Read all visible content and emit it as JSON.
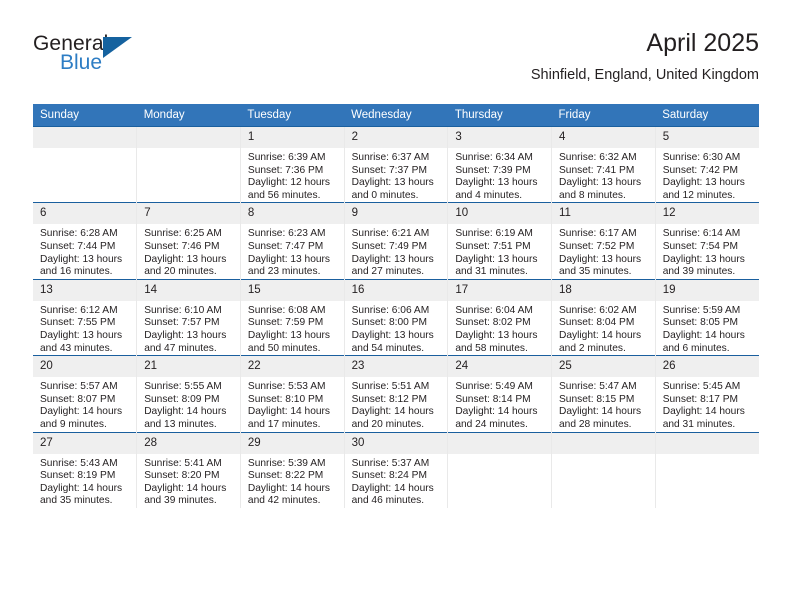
{
  "brand": {
    "name_top": "General",
    "name_bottom": "Blue",
    "triangle_color": "#15629f",
    "blue_text_color": "#2d7dc4"
  },
  "header": {
    "title": "April 2025",
    "subtitle": "Shinfield, England, United Kingdom"
  },
  "theme": {
    "header_bg": "#3275b9",
    "row_divider": "#1a5f9e",
    "daynum_bg": "#efefef",
    "text": "#231f20"
  },
  "weekday_headers": [
    "Sunday",
    "Monday",
    "Tuesday",
    "Wednesday",
    "Thursday",
    "Friday",
    "Saturday"
  ],
  "weeks": [
    [
      {
        "day": "",
        "lines": []
      },
      {
        "day": "",
        "lines": []
      },
      {
        "day": "1",
        "lines": [
          "Sunrise: 6:39 AM",
          "Sunset: 7:36 PM",
          "Daylight: 12 hours",
          "and 56 minutes."
        ]
      },
      {
        "day": "2",
        "lines": [
          "Sunrise: 6:37 AM",
          "Sunset: 7:37 PM",
          "Daylight: 13 hours",
          "and 0 minutes."
        ]
      },
      {
        "day": "3",
        "lines": [
          "Sunrise: 6:34 AM",
          "Sunset: 7:39 PM",
          "Daylight: 13 hours",
          "and 4 minutes."
        ]
      },
      {
        "day": "4",
        "lines": [
          "Sunrise: 6:32 AM",
          "Sunset: 7:41 PM",
          "Daylight: 13 hours",
          "and 8 minutes."
        ]
      },
      {
        "day": "5",
        "lines": [
          "Sunrise: 6:30 AM",
          "Sunset: 7:42 PM",
          "Daylight: 13 hours",
          "and 12 minutes."
        ]
      }
    ],
    [
      {
        "day": "6",
        "lines": [
          "Sunrise: 6:28 AM",
          "Sunset: 7:44 PM",
          "Daylight: 13 hours",
          "and 16 minutes."
        ]
      },
      {
        "day": "7",
        "lines": [
          "Sunrise: 6:25 AM",
          "Sunset: 7:46 PM",
          "Daylight: 13 hours",
          "and 20 minutes."
        ]
      },
      {
        "day": "8",
        "lines": [
          "Sunrise: 6:23 AM",
          "Sunset: 7:47 PM",
          "Daylight: 13 hours",
          "and 23 minutes."
        ]
      },
      {
        "day": "9",
        "lines": [
          "Sunrise: 6:21 AM",
          "Sunset: 7:49 PM",
          "Daylight: 13 hours",
          "and 27 minutes."
        ]
      },
      {
        "day": "10",
        "lines": [
          "Sunrise: 6:19 AM",
          "Sunset: 7:51 PM",
          "Daylight: 13 hours",
          "and 31 minutes."
        ]
      },
      {
        "day": "11",
        "lines": [
          "Sunrise: 6:17 AM",
          "Sunset: 7:52 PM",
          "Daylight: 13 hours",
          "and 35 minutes."
        ]
      },
      {
        "day": "12",
        "lines": [
          "Sunrise: 6:14 AM",
          "Sunset: 7:54 PM",
          "Daylight: 13 hours",
          "and 39 minutes."
        ]
      }
    ],
    [
      {
        "day": "13",
        "lines": [
          "Sunrise: 6:12 AM",
          "Sunset: 7:55 PM",
          "Daylight: 13 hours",
          "and 43 minutes."
        ]
      },
      {
        "day": "14",
        "lines": [
          "Sunrise: 6:10 AM",
          "Sunset: 7:57 PM",
          "Daylight: 13 hours",
          "and 47 minutes."
        ]
      },
      {
        "day": "15",
        "lines": [
          "Sunrise: 6:08 AM",
          "Sunset: 7:59 PM",
          "Daylight: 13 hours",
          "and 50 minutes."
        ]
      },
      {
        "day": "16",
        "lines": [
          "Sunrise: 6:06 AM",
          "Sunset: 8:00 PM",
          "Daylight: 13 hours",
          "and 54 minutes."
        ]
      },
      {
        "day": "17",
        "lines": [
          "Sunrise: 6:04 AM",
          "Sunset: 8:02 PM",
          "Daylight: 13 hours",
          "and 58 minutes."
        ]
      },
      {
        "day": "18",
        "lines": [
          "Sunrise: 6:02 AM",
          "Sunset: 8:04 PM",
          "Daylight: 14 hours",
          "and 2 minutes."
        ]
      },
      {
        "day": "19",
        "lines": [
          "Sunrise: 5:59 AM",
          "Sunset: 8:05 PM",
          "Daylight: 14 hours",
          "and 6 minutes."
        ]
      }
    ],
    [
      {
        "day": "20",
        "lines": [
          "Sunrise: 5:57 AM",
          "Sunset: 8:07 PM",
          "Daylight: 14 hours",
          "and 9 minutes."
        ]
      },
      {
        "day": "21",
        "lines": [
          "Sunrise: 5:55 AM",
          "Sunset: 8:09 PM",
          "Daylight: 14 hours",
          "and 13 minutes."
        ]
      },
      {
        "day": "22",
        "lines": [
          "Sunrise: 5:53 AM",
          "Sunset: 8:10 PM",
          "Daylight: 14 hours",
          "and 17 minutes."
        ]
      },
      {
        "day": "23",
        "lines": [
          "Sunrise: 5:51 AM",
          "Sunset: 8:12 PM",
          "Daylight: 14 hours",
          "and 20 minutes."
        ]
      },
      {
        "day": "24",
        "lines": [
          "Sunrise: 5:49 AM",
          "Sunset: 8:14 PM",
          "Daylight: 14 hours",
          "and 24 minutes."
        ]
      },
      {
        "day": "25",
        "lines": [
          "Sunrise: 5:47 AM",
          "Sunset: 8:15 PM",
          "Daylight: 14 hours",
          "and 28 minutes."
        ]
      },
      {
        "day": "26",
        "lines": [
          "Sunrise: 5:45 AM",
          "Sunset: 8:17 PM",
          "Daylight: 14 hours",
          "and 31 minutes."
        ]
      }
    ],
    [
      {
        "day": "27",
        "lines": [
          "Sunrise: 5:43 AM",
          "Sunset: 8:19 PM",
          "Daylight: 14 hours",
          "and 35 minutes."
        ]
      },
      {
        "day": "28",
        "lines": [
          "Sunrise: 5:41 AM",
          "Sunset: 8:20 PM",
          "Daylight: 14 hours",
          "and 39 minutes."
        ]
      },
      {
        "day": "29",
        "lines": [
          "Sunrise: 5:39 AM",
          "Sunset: 8:22 PM",
          "Daylight: 14 hours",
          "and 42 minutes."
        ]
      },
      {
        "day": "30",
        "lines": [
          "Sunrise: 5:37 AM",
          "Sunset: 8:24 PM",
          "Daylight: 14 hours",
          "and 46 minutes."
        ]
      },
      {
        "day": "",
        "lines": []
      },
      {
        "day": "",
        "lines": []
      },
      {
        "day": "",
        "lines": []
      }
    ]
  ]
}
